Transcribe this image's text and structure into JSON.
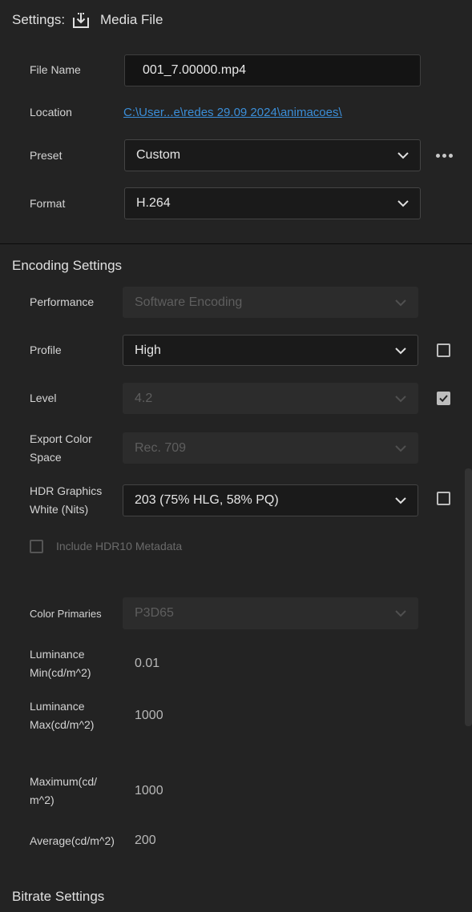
{
  "header": {
    "title": "Settings:",
    "subtitle": "Media File"
  },
  "file_name": {
    "label": "File Name",
    "value": "001_7.00000.mp4"
  },
  "location": {
    "label": "Location",
    "value": "C:\\User...e\\redes 29.09 2024\\animacoes\\"
  },
  "preset": {
    "label": "Preset",
    "value": "Custom"
  },
  "format": {
    "label": "Format",
    "value": "H.264"
  },
  "encoding": {
    "title": "Encoding Settings",
    "performance": {
      "label": "Performance",
      "value": "Software Encoding"
    },
    "profile": {
      "label": "Profile",
      "value": "High",
      "override_checked": false
    },
    "level": {
      "label": "Level",
      "value": "4.2",
      "override_checked": true
    },
    "color_space": {
      "label_line1": "Export Color",
      "label_line2": "Space",
      "value": "Rec. 709"
    },
    "hdr_white": {
      "label_line1": "HDR Graphics",
      "label_line2": "White (Nits)",
      "value": "203 (75% HLG, 58% PQ)",
      "override_checked": false
    },
    "hdr10_metadata": {
      "label": "Include HDR10 Metadata",
      "checked": false
    },
    "color_primaries": {
      "label": "Color Primaries",
      "value": "P3D65"
    },
    "lum_min": {
      "label_line1": "Luminance",
      "label_line2": "Min(cd/m^2)",
      "value": "0.01"
    },
    "lum_max": {
      "label_line1": "Luminance",
      "label_line2": "Max(cd/m^2)",
      "value": "1000"
    },
    "maximum": {
      "label_line1": "Maximum(cd/",
      "label_line2": "m^2)",
      "value": "1000"
    },
    "average": {
      "label": "Average(cd/m^2)",
      "value": "200"
    }
  },
  "bitrate": {
    "title": "Bitrate Settings"
  },
  "icons": {
    "export": "export-download-icon",
    "more": "more-horizontal-icon",
    "chevron": "chevron-down-icon"
  }
}
